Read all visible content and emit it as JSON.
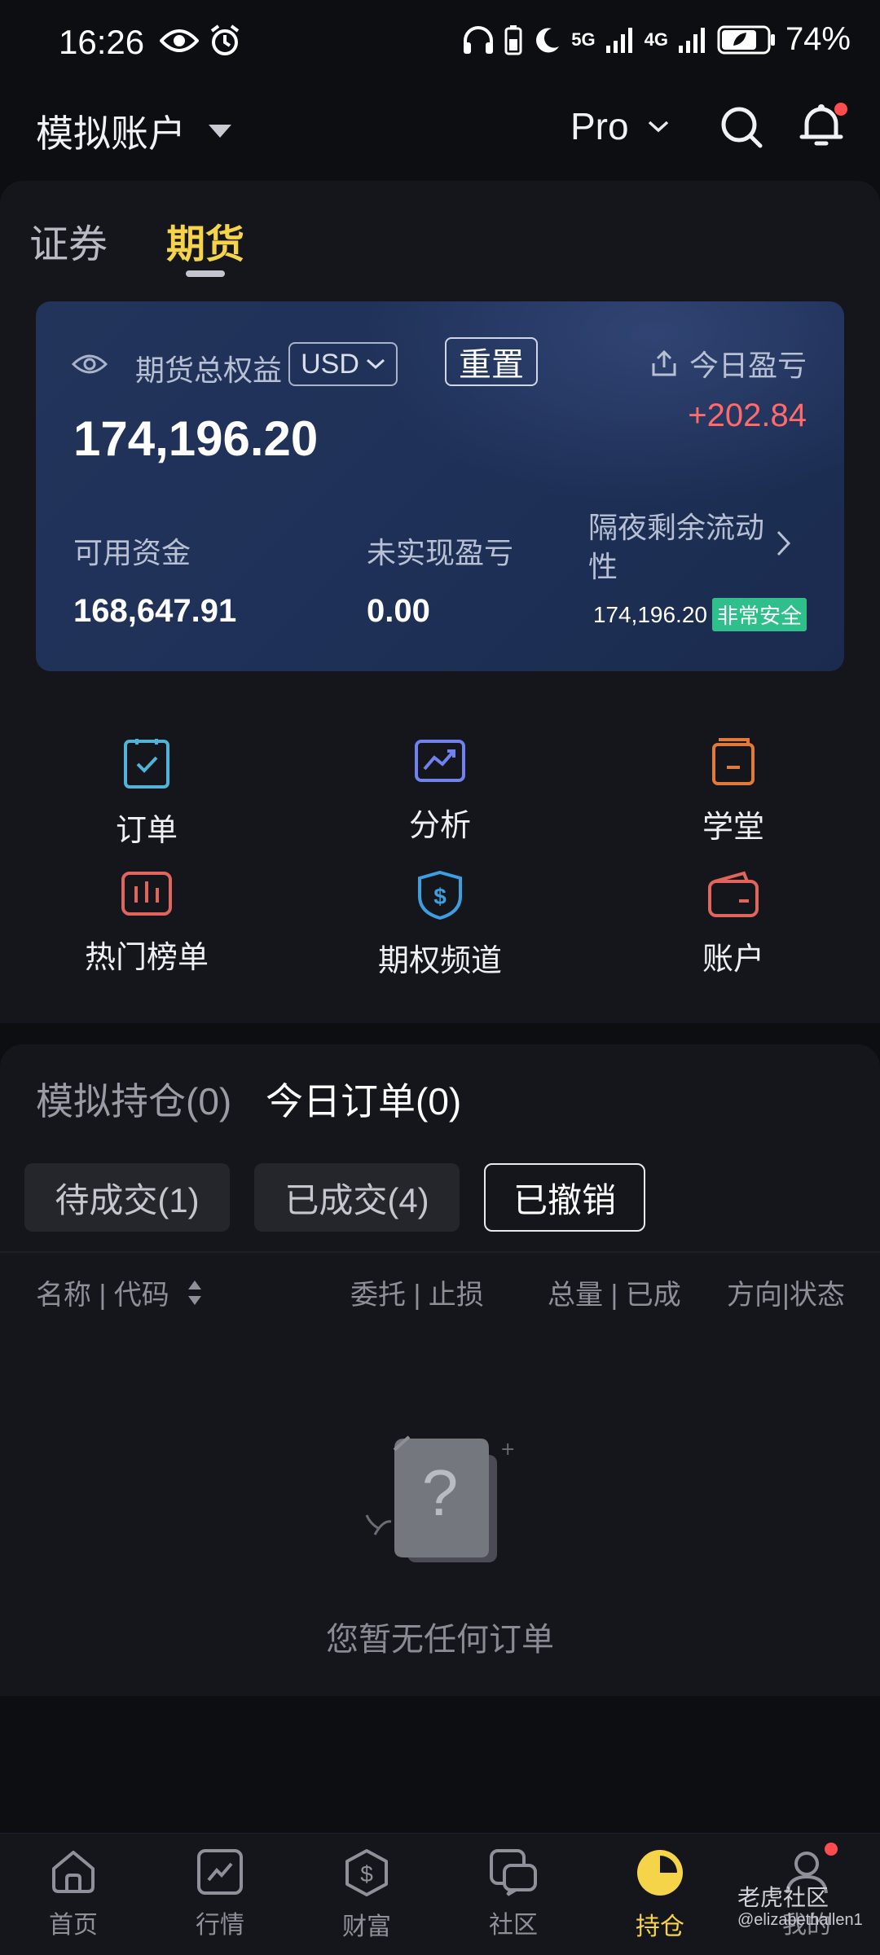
{
  "status_bar": {
    "time": "16:26",
    "battery": "74%",
    "net1": "5G",
    "net2": "4G"
  },
  "header": {
    "account": "模拟账户",
    "mode": "Pro"
  },
  "tabs": [
    "证券",
    "期货"
  ],
  "equity_card": {
    "title": "期货总权益",
    "currency": "USD",
    "reset_label": "重置",
    "total": "174,196.20",
    "today_pl_label": "今日盈亏",
    "today_pl": "+202.84",
    "available_label": "可用资金",
    "available": "168,647.91",
    "unrealized_label": "未实现盈亏",
    "unrealized": "0.00",
    "liquidity_label_line1": "隔夜剩余流动",
    "liquidity_label_line2": "性",
    "liquidity": "174,196.20",
    "safety_badge": "非常安全"
  },
  "quick_actions": [
    {
      "label": "订单",
      "icon": "order-icon"
    },
    {
      "label": "分析",
      "icon": "analysis-icon"
    },
    {
      "label": "学堂",
      "icon": "academy-icon"
    },
    {
      "label": "热门榜单",
      "icon": "ranking-icon"
    },
    {
      "label": "期权频道",
      "icon": "options-icon"
    },
    {
      "label": "账户",
      "icon": "wallet-icon"
    }
  ],
  "orders_panel": {
    "tabs": [
      "模拟持仓(0)",
      "今日订单(0)"
    ],
    "filters": [
      "待成交(1)",
      "已成交(4)",
      "已撤销"
    ],
    "columns": [
      "名称 | 代码",
      "委托 | 止损",
      "总量 | 已成",
      "方向|状态"
    ],
    "empty_text": "您暂无任何订单"
  },
  "bottom_nav": [
    "首页",
    "行情",
    "财富",
    "社区",
    "持仓",
    "我的"
  ],
  "watermark": {
    "brand": "老虎社区",
    "user": "@elizabethallen1"
  },
  "colors": {
    "accent": "#f6d44a",
    "profit": "#ff6b6b",
    "safe": "#2fbf8a"
  }
}
